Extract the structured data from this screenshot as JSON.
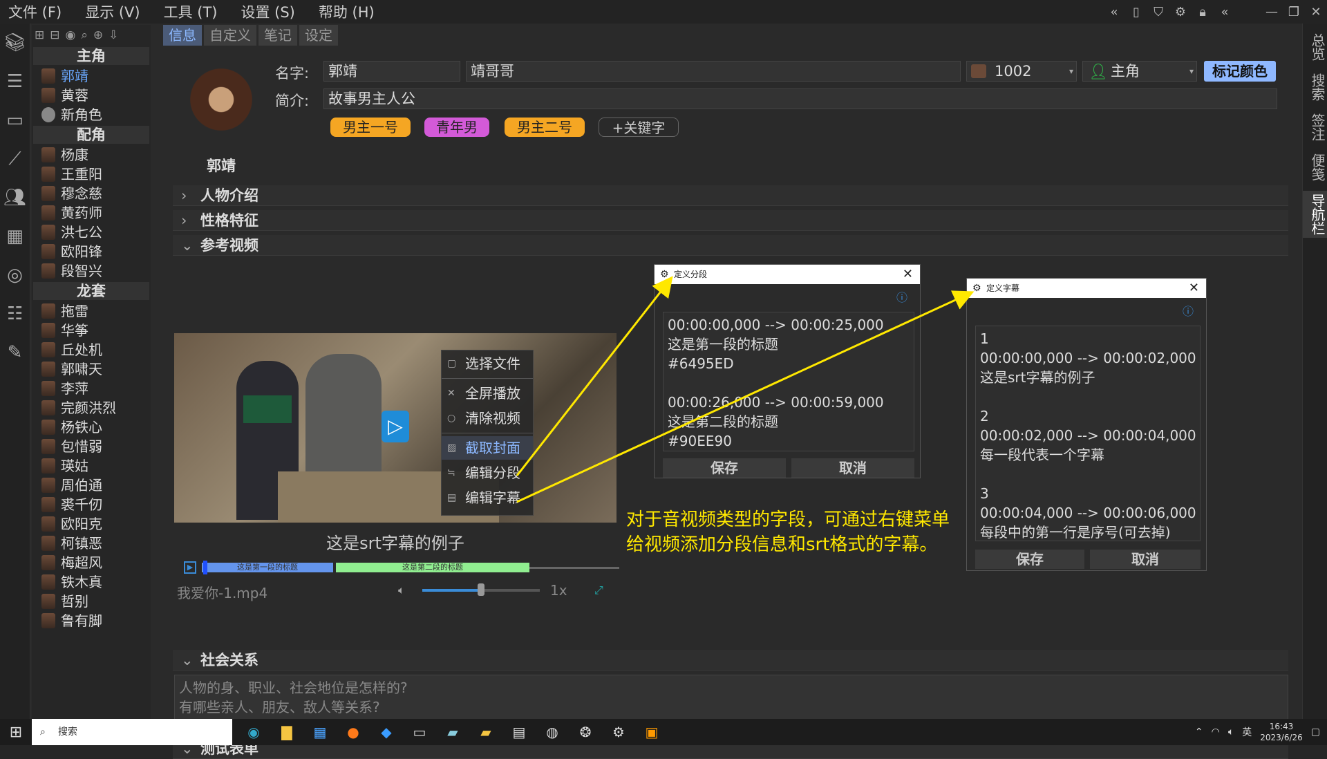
{
  "menubar": {
    "items": [
      "文件 (F)",
      "显示 (V)",
      "工具 (T)",
      "设置 (S)",
      "帮助 (H)"
    ]
  },
  "right_tabs": [
    "总览",
    "搜索",
    "签注",
    "便笺",
    "导航栏"
  ],
  "char_list": {
    "groups": [
      {
        "title": "主角",
        "items": [
          "郭靖",
          "黄蓉",
          "新角色"
        ]
      },
      {
        "title": "配角",
        "items": [
          "杨康",
          "王重阳",
          "穆念慈",
          "黄药师",
          "洪七公",
          "欧阳锋",
          "段智兴"
        ]
      },
      {
        "title": "龙套",
        "items": [
          "拖雷",
          "华筝",
          "丘处机",
          "郭啸天",
          "李萍",
          "完颜洪烈",
          "杨铁心",
          "包惜弱",
          "瑛姑",
          "周伯通",
          "裘千仞",
          "欧阳克",
          "柯镇恶",
          "梅超风",
          "铁木真",
          "哲别",
          "鲁有脚"
        ]
      }
    ]
  },
  "tabs": [
    "信息",
    "自定义",
    "笔记",
    "设定"
  ],
  "info": {
    "portrait_name": "郭靖",
    "name_label": "名字:",
    "name_value": "郭靖",
    "alias_value": "靖哥哥",
    "id_value": "1002",
    "role_value": "主角",
    "color_btn": "标记颜色",
    "desc_label": "简介:",
    "desc_value": "故事男主人公",
    "tags": [
      "男主一号",
      "青年男",
      "男主二号"
    ],
    "add_tag": "+关键字"
  },
  "sections": {
    "intro": "人物介绍",
    "trait": "性格特征",
    "video": "参考视频",
    "social": "社会关系",
    "form": "测试表单"
  },
  "video": {
    "context_menu": [
      "选择文件",
      "全屏播放",
      "清除视频",
      "截取封面",
      "编辑分段",
      "编辑字幕"
    ],
    "subtitle": "这是srt字幕的例子",
    "seg1": "这是第一段的标题",
    "seg2": "这是第二段的标题",
    "seg1_color": "#6495ED",
    "seg2_color": "#90EE90",
    "filename": "我爱你-1.mp4",
    "speed": "1x"
  },
  "social_placeholder_1": "人物的身、职业、社会地位是怎样的?",
  "social_placeholder_2": "有哪些亲人、朋友、敌人等关系?",
  "dialog_segments": {
    "title": "定义分段",
    "lines": "00:00:00,000 --> 00:00:25,000\n这是第一段的标题\n#6495ED\n\n00:00:26,000 --> 00:00:59,000\n这是第二段的标题\n#90EE90",
    "save": "保存",
    "cancel": "取消"
  },
  "dialog_subs": {
    "title": "定义字幕",
    "lines": "1\n00:00:00,000 --> 00:00:02,000\n这是srt字幕的例子\n\n2\n00:00:02,000 --> 00:00:04,000\n每一段代表一个字幕\n\n3\n00:00:04,000 --> 00:00:06,000\n每段中的第一行是序号(可去掉)",
    "save": "保存",
    "cancel": "取消"
  },
  "annotation_1": "对于音视频类型的字段，可通过右键菜单",
  "annotation_2": "给视频添加分段信息和srt格式的字幕。",
  "taskbar": {
    "search": "搜索",
    "ime": "英",
    "time": "16:43",
    "date": "2023/6/26"
  }
}
